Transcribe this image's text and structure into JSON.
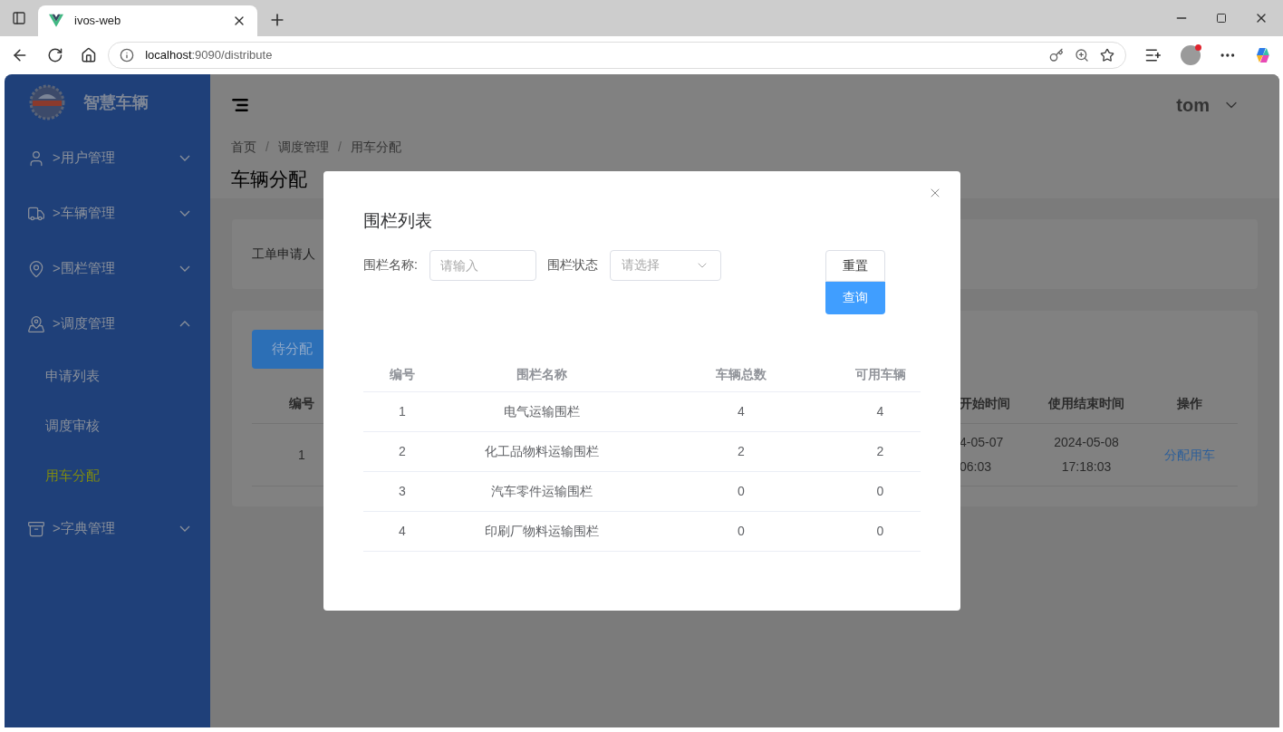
{
  "browser": {
    "tab_title": "ivos-web",
    "url_host": "localhost",
    "url_rest": ":9090/distribute"
  },
  "sidebar": {
    "brand": "智慧车辆",
    "menus": [
      {
        "label": ">用户管理",
        "expanded": false
      },
      {
        "label": ">车辆管理",
        "expanded": false
      },
      {
        "label": ">围栏管理",
        "expanded": false
      },
      {
        "label": ">调度管理",
        "expanded": true,
        "children": [
          {
            "label": "申请列表",
            "selected": false
          },
          {
            "label": "调度审核",
            "selected": false
          },
          {
            "label": "用车分配",
            "selected": true
          }
        ]
      },
      {
        "label": ">字典管理",
        "expanded": false
      }
    ]
  },
  "header": {
    "user": "tom",
    "breadcrumb": [
      "首页",
      "调度管理",
      "用车分配"
    ],
    "breadcrumb_separator": "/",
    "page_title": "车辆分配"
  },
  "filter_card": {
    "label": "工单申请人"
  },
  "list_card": {
    "tabs": [
      {
        "label": "待分配",
        "selected": true
      }
    ],
    "columns": [
      "编号",
      "开始时间",
      "使用结束时间",
      "操作"
    ],
    "rows": [
      {
        "id": "1",
        "start_date": "4-05-07",
        "start_time": "06:03",
        "end_date": "2024-05-08",
        "end_time": "17:18:03",
        "action": "分配用车"
      }
    ]
  },
  "dialog": {
    "title": "围栏列表",
    "name_label": "围栏名称:",
    "name_placeholder": "请输入",
    "status_label": "围栏状态",
    "status_placeholder": "请选择",
    "reset": "重置",
    "query": "查询",
    "columns": [
      "编号",
      "围栏名称",
      "车辆总数",
      "可用车辆"
    ],
    "rows": [
      {
        "cells": [
          "1",
          "电气运输围栏",
          "4",
          "4"
        ]
      },
      {
        "cells": [
          "2",
          "化工品物料运输围栏",
          "2",
          "2"
        ]
      },
      {
        "cells": [
          "3",
          "汽车零件运输围栏",
          "0",
          "0"
        ]
      },
      {
        "cells": [
          "4",
          "印刷厂物料运输围栏",
          "0",
          "0"
        ]
      }
    ]
  }
}
